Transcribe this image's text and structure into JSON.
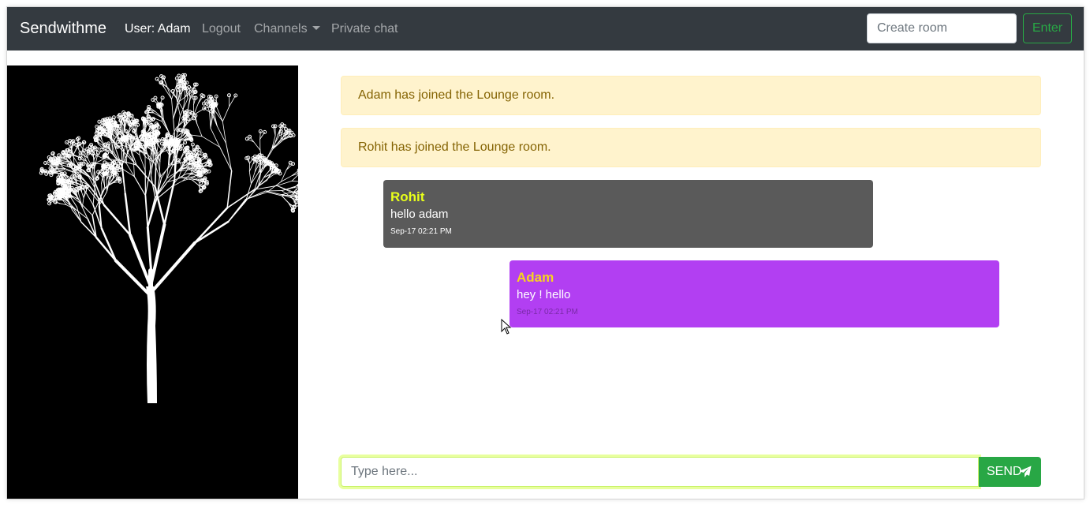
{
  "navbar": {
    "brand": "Sendwithme",
    "user_label": "User: Adam",
    "logout": "Logout",
    "channels": "Channels",
    "private_chat": "Private chat",
    "create_room_placeholder": "Create room",
    "enter_button": "Enter"
  },
  "sidebar_image": {
    "icon": "tree-illustration"
  },
  "chat": {
    "notifications": [
      "Adam has joined the Lounge room.",
      "Rohit has joined the Lounge room."
    ],
    "messages": [
      {
        "author": "Rohit",
        "text": "hello adam",
        "time": "Sep-17 02:21 PM"
      },
      {
        "author": "Adam",
        "text": "hey ! hello",
        "time": "Sep-17 02:21 PM"
      }
    ],
    "input_placeholder": "Type here...",
    "send_button": "SEND",
    "send_icon": "paper-plane-icon"
  },
  "colors": {
    "navbar_bg": "#343a40",
    "alert_bg": "#fff3cd",
    "alert_text": "#856404",
    "rohit_bubble": "#5a5a5a",
    "rohit_name": "#e8ff1a",
    "adam_bubble": "#b23ff2",
    "adam_name": "#f7d41e",
    "success": "#28a745"
  }
}
